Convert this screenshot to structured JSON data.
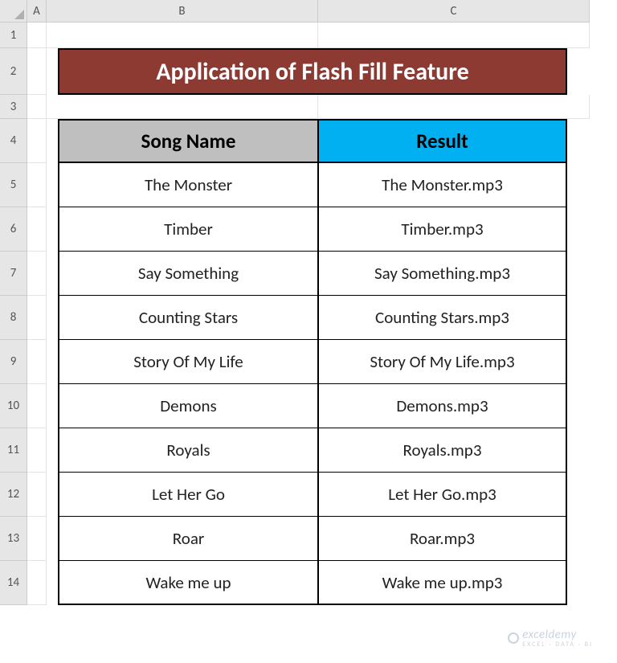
{
  "columns": [
    "A",
    "B",
    "C"
  ],
  "rows": [
    "1",
    "2",
    "3",
    "4",
    "5",
    "6",
    "7",
    "8",
    "9",
    "10",
    "11",
    "12",
    "13",
    "14"
  ],
  "title": "Application of Flash Fill Feature",
  "table": {
    "headers": {
      "song": "Song Name",
      "result": "Result"
    },
    "data": [
      {
        "song": "The Monster",
        "result": "The Monster.mp3"
      },
      {
        "song": "Timber",
        "result": "Timber.mp3"
      },
      {
        "song": "Say Something",
        "result": "Say Something.mp3"
      },
      {
        "song": "Counting Stars",
        "result": "Counting Stars.mp3"
      },
      {
        "song": "Story Of My Life",
        "result": "Story Of My Life.mp3"
      },
      {
        "song": "Demons",
        "result": "Demons.mp3"
      },
      {
        "song": "Royals",
        "result": "Royals.mp3"
      },
      {
        "song": "Let Her Go",
        "result": "Let Her Go.mp3"
      },
      {
        "song": "Roar",
        "result": "Roar.mp3"
      },
      {
        "song": "Wake me up",
        "result": "Wake me up.mp3"
      }
    ]
  },
  "watermark": {
    "brand": "exceldemy",
    "tagline": "EXCEL · DATA · BI"
  },
  "colors": {
    "titleBg": "#8d3a33",
    "songHeaderBg": "#bfbfbf",
    "resultHeaderBg": "#00b0f0"
  }
}
